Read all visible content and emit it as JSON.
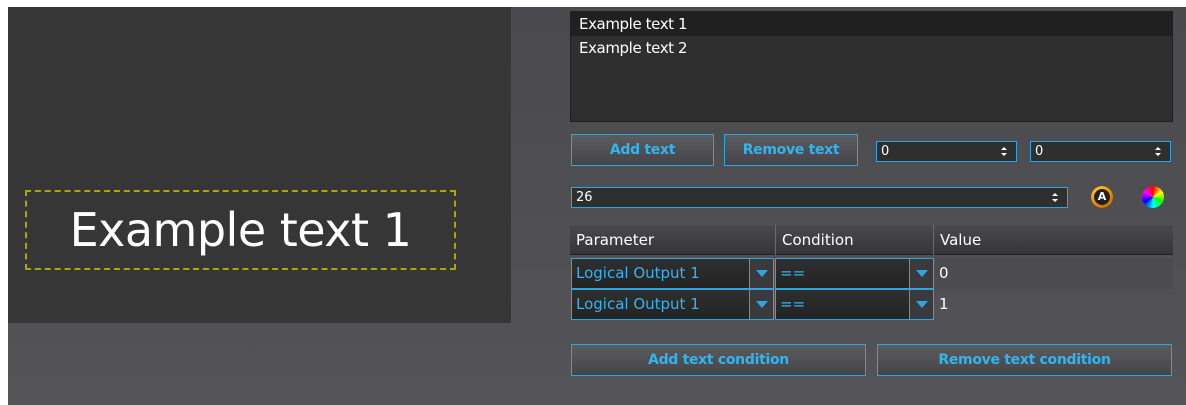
{
  "preview": {
    "text": "Example text 1",
    "frame_color": "#a9a900"
  },
  "text_list": {
    "items": [
      "Example text 1",
      "Example text 2"
    ],
    "selected_index": 0
  },
  "buttons": {
    "add_text": "Add text",
    "remove_text": "Remove text",
    "add_condition": "Add text condition",
    "remove_condition": "Remove text condition"
  },
  "spinners": {
    "pos_x": "0",
    "pos_y": "0",
    "font_size": "26"
  },
  "icons": {
    "font": "font-picker-icon",
    "color": "color-picker-icon",
    "font_glyph": "A"
  },
  "conditions_table": {
    "headers": [
      "Parameter",
      "Condition",
      "Value"
    ],
    "rows": [
      {
        "parameter": "Logical Output 1",
        "condition": "==",
        "value": "0"
      },
      {
        "parameter": "Logical Output 1",
        "condition": "==",
        "value": "1"
      }
    ]
  },
  "colors": {
    "accent": "#2ea6dd",
    "background": "#4e4e52",
    "preview_bg": "#363636"
  }
}
